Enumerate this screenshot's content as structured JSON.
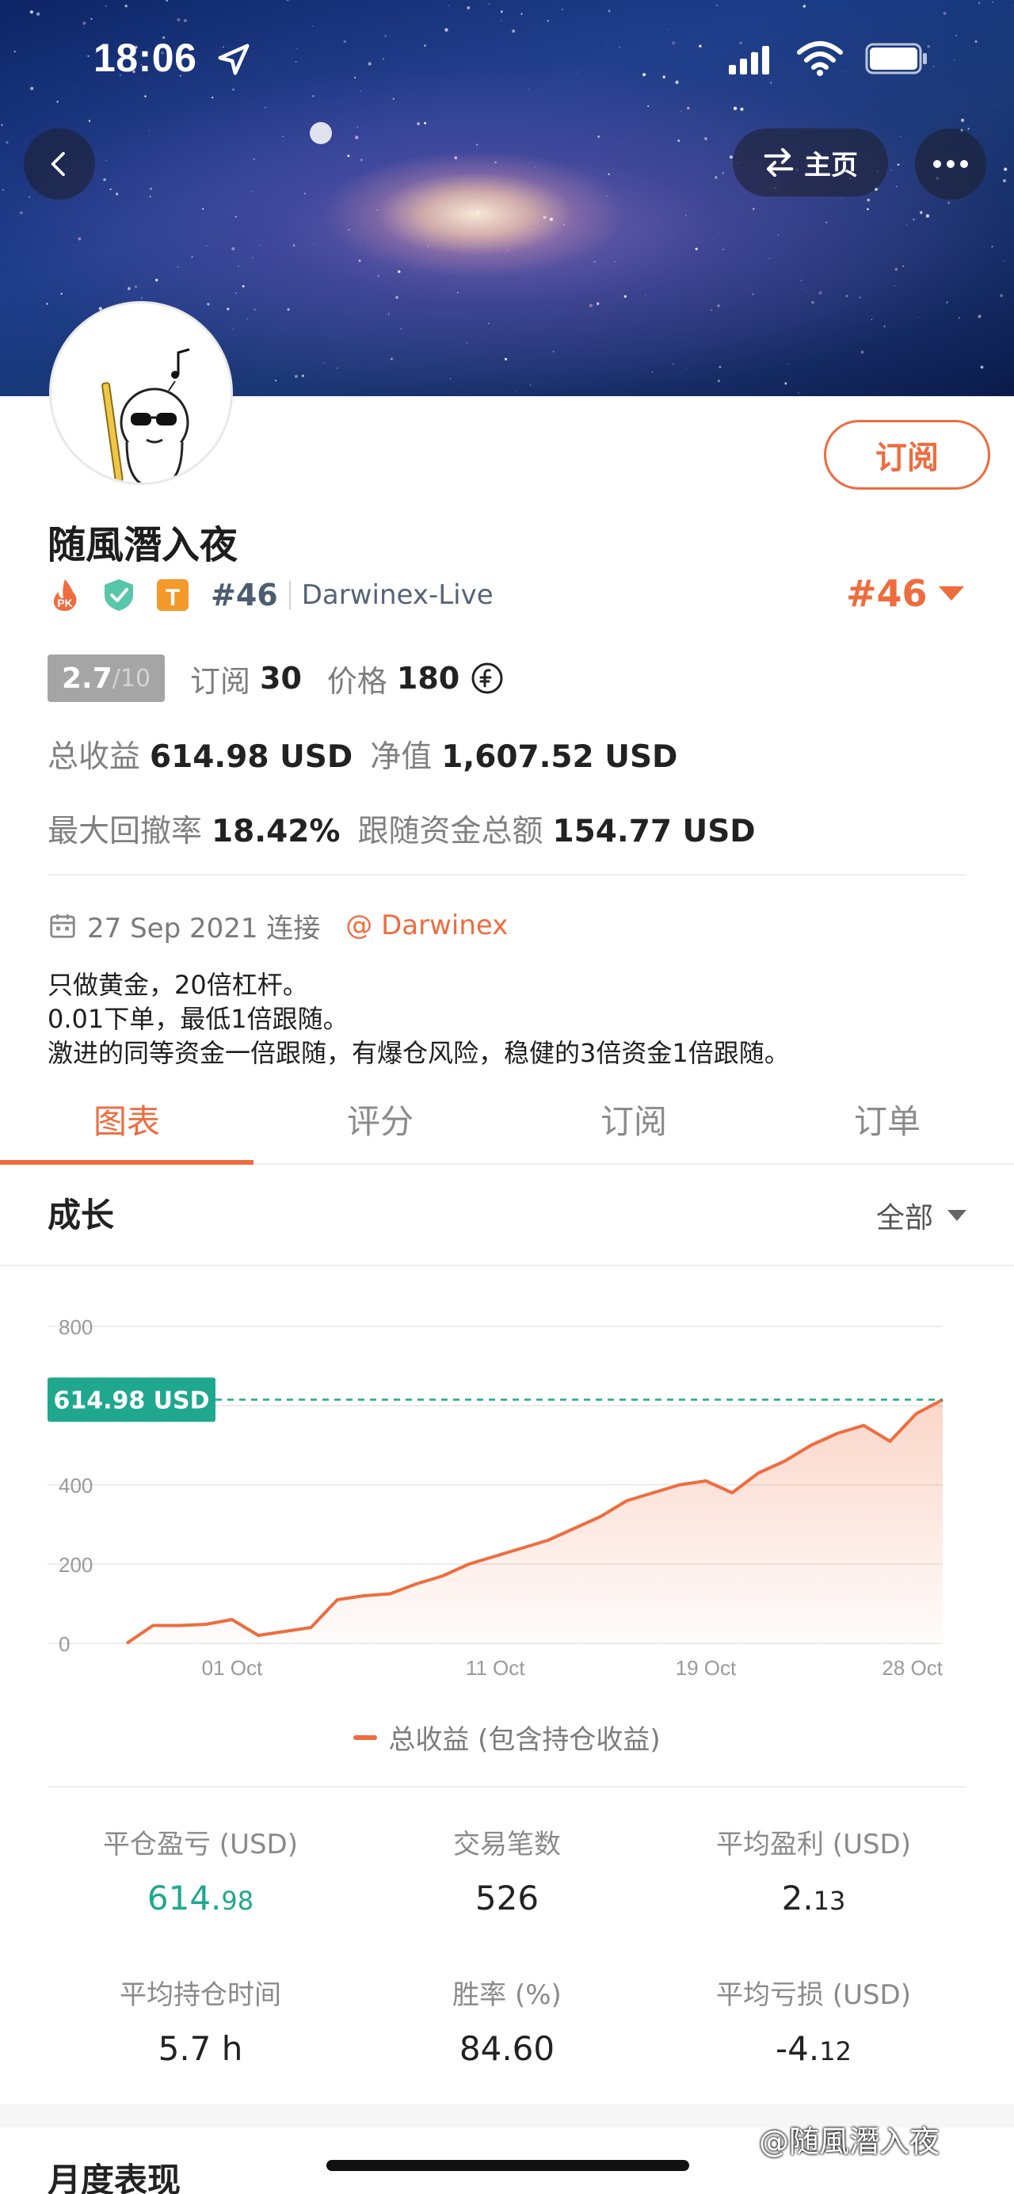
{
  "status_bar": {
    "time": "18:06"
  },
  "header": {
    "home_label": "主页"
  },
  "profile": {
    "username": "随風潛入夜",
    "rank_small": "#46",
    "broker": "Darwinex-Live",
    "rank_big": "#46",
    "subscribe_label": "订阅",
    "score": "2.7",
    "score_denominator": "/10",
    "subscriptions_label": "订阅",
    "subscriptions_value": "30",
    "price_label": "价格",
    "price_value": "180",
    "total_profit_label": "总收益",
    "total_profit_value": "614.98 USD",
    "equity_label": "净值",
    "equity_value": "1,607.52 USD",
    "max_drawdown_label": "最大回撤率",
    "max_drawdown_value": "18.42%",
    "follow_funds_label": "跟随资金总额",
    "follow_funds_value": "154.77 USD",
    "connect_date": "27 Sep 2021 连接",
    "connect_source": "@ Darwinex",
    "bio": [
      "只做黄金，20倍杠杆。",
      "0.01下单，最低1倍跟随。",
      "激进的同等资金一倍跟随，有爆仓风险，稳健的3倍资金1倍跟随。"
    ]
  },
  "tabs": [
    {
      "label": "图表",
      "active": true
    },
    {
      "label": "评分",
      "active": false
    },
    {
      "label": "订阅",
      "active": false
    },
    {
      "label": "订单",
      "active": false
    }
  ],
  "growth": {
    "title": "成长",
    "filter": "全部"
  },
  "chart_data": {
    "type": "area",
    "series": [
      {
        "name": "总收益 (包含持仓收益)",
        "x": [
          "2021-09-27",
          "2021-09-28",
          "2021-09-29",
          "2021-09-30",
          "2021-10-01",
          "2021-10-02",
          "2021-10-03",
          "2021-10-04",
          "2021-10-05",
          "2021-10-06",
          "2021-10-07",
          "2021-10-08",
          "2021-10-09",
          "2021-10-10",
          "2021-10-11",
          "2021-10-12",
          "2021-10-13",
          "2021-10-14",
          "2021-10-15",
          "2021-10-16",
          "2021-10-17",
          "2021-10-18",
          "2021-10-19",
          "2021-10-20",
          "2021-10-21",
          "2021-10-22",
          "2021-10-23",
          "2021-10-24",
          "2021-10-25",
          "2021-10-26",
          "2021-10-27",
          "2021-10-28"
        ],
        "values": [
          0,
          45,
          45,
          48,
          60,
          20,
          30,
          40,
          110,
          120,
          125,
          150,
          170,
          200,
          220,
          240,
          260,
          290,
          320,
          360,
          380,
          400,
          410,
          380,
          430,
          460,
          500,
          530,
          550,
          510,
          580,
          614.98
        ]
      }
    ],
    "xticks": [
      "01 Oct",
      "11 Oct",
      "19 Oct",
      "28 Oct"
    ],
    "yticks": [
      0,
      200,
      400,
      800
    ],
    "ylim": [
      0,
      800
    ],
    "reference_label": "614.98 USD",
    "legend": "总收益 (包含持仓收益)",
    "grid": true,
    "color": "#ef6c3e",
    "reference_color": "#1fa88e"
  },
  "metrics": [
    {
      "label": "平仓盈亏 (USD)",
      "int": "614.",
      "dec": "98",
      "green": true
    },
    {
      "label": "交易笔数",
      "int": "526",
      "dec": "",
      "green": false
    },
    {
      "label": "平均盈利 (USD)",
      "int": "2.",
      "dec": "13",
      "green": false
    },
    {
      "label": "平均持仓时间",
      "int": "5.7 h",
      "dec": "",
      "green": false
    },
    {
      "label": "胜率 (%)",
      "int": "84.60",
      "dec": "",
      "green": false
    },
    {
      "label": "平均亏损 (USD)",
      "int": "-4.",
      "dec": "12",
      "green": false
    }
  ],
  "monthly_title": "月度表现",
  "watermark": "@随風潛入夜"
}
